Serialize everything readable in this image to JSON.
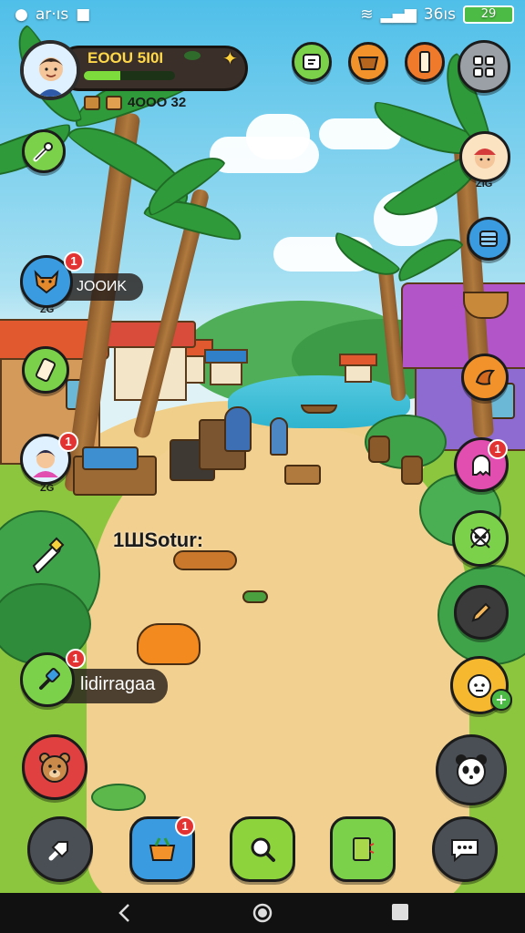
{
  "status_bar": {
    "time": "ar·ıs",
    "network": "36ıs",
    "battery": "29"
  },
  "player": {
    "name": "EOOU 5I0I",
    "xp_progress": 0.4,
    "resource_value": "4OOO 32"
  },
  "villager_tag": {
    "name": "JOOИK",
    "level": "ZG"
  },
  "villager_bottom": {
    "level": "ZG"
  },
  "top_right_villager": {
    "level": "ZIG"
  },
  "floating_text": "1ШSotur:",
  "quest_label": "lidirragaa",
  "badges": {
    "notify": "1"
  },
  "colors": {
    "accent_green": "#8cd33c",
    "accent_orange": "#f2922a",
    "accent_red": "#e23232",
    "accent_pink": "#e24db0"
  }
}
